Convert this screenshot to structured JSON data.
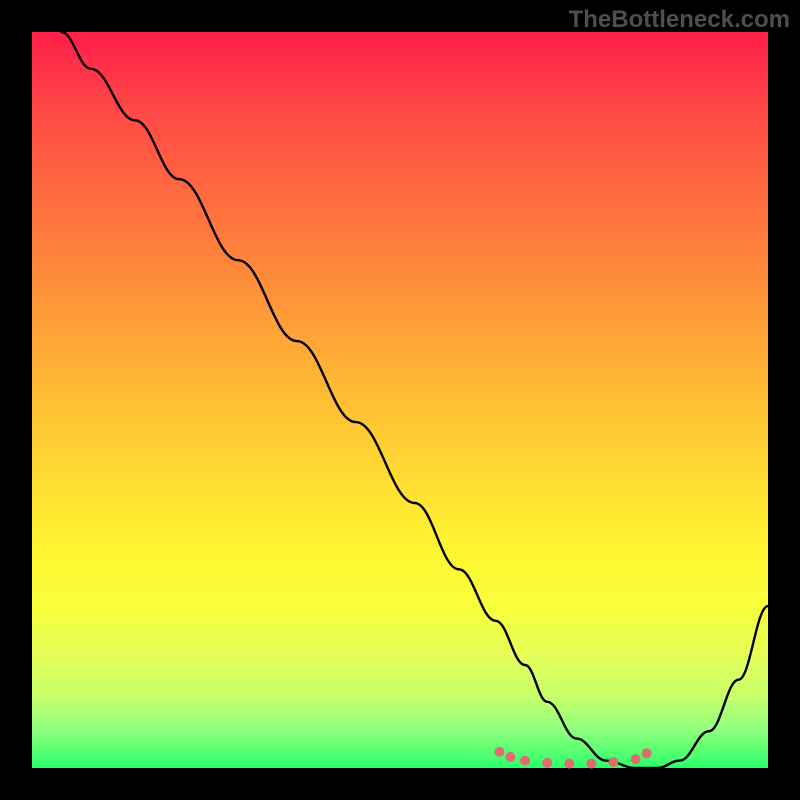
{
  "watermark": "TheBottleneck.com",
  "chart_data": {
    "type": "line",
    "title": "",
    "xlabel": "",
    "ylabel": "",
    "xlim": [
      0,
      100
    ],
    "ylim": [
      0,
      100
    ],
    "series": [
      {
        "name": "curve",
        "color": "#000000",
        "x": [
          4,
          8,
          14,
          20,
          28,
          36,
          44,
          52,
          58,
          63,
          67,
          70,
          74,
          78,
          82,
          85,
          88,
          92,
          96,
          100
        ],
        "y": [
          100,
          95,
          88,
          80,
          69,
          58,
          47,
          36,
          27,
          20,
          14,
          9,
          4,
          1,
          0,
          0,
          1,
          5,
          12,
          22
        ]
      },
      {
        "name": "highlight-dots",
        "color": "#de6e6e",
        "x": [
          63.5,
          65,
          67,
          70,
          73,
          76,
          79,
          82,
          83.5
        ],
        "y": [
          2.2,
          1.5,
          1.0,
          0.7,
          0.6,
          0.6,
          0.8,
          1.2,
          2.0
        ]
      }
    ],
    "gradient_stops": [
      {
        "pos": 0.0,
        "color": "#ff1f4b"
      },
      {
        "pos": 0.1,
        "color": "#ff4646"
      },
      {
        "pos": 0.22,
        "color": "#ff6a3f"
      },
      {
        "pos": 0.34,
        "color": "#ff8d3a"
      },
      {
        "pos": 0.46,
        "color": "#ffb236"
      },
      {
        "pos": 0.58,
        "color": "#ffd433"
      },
      {
        "pos": 0.7,
        "color": "#fff531"
      },
      {
        "pos": 0.78,
        "color": "#f7ff3a"
      },
      {
        "pos": 0.84,
        "color": "#e6ff55"
      },
      {
        "pos": 0.9,
        "color": "#c9ff6a"
      },
      {
        "pos": 0.95,
        "color": "#8dff7d"
      },
      {
        "pos": 1.0,
        "color": "#2bff6a"
      }
    ]
  }
}
